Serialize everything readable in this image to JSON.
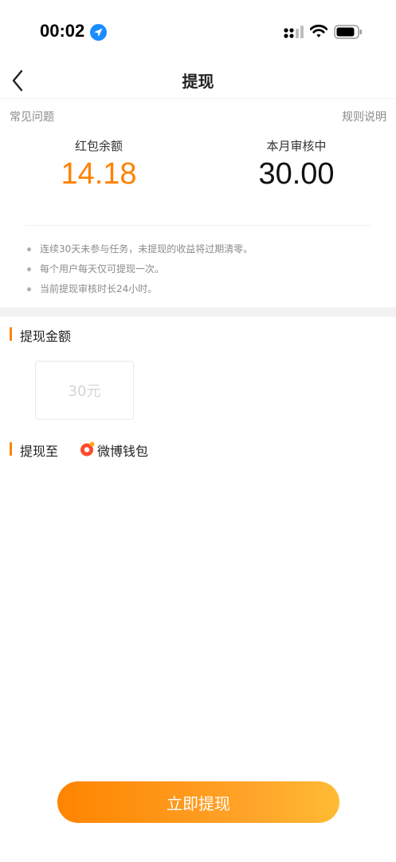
{
  "status_bar": {
    "time": "00:02"
  },
  "nav": {
    "title": "提现"
  },
  "links": {
    "faq": "常见问题",
    "rules": "规则说明"
  },
  "balances": {
    "red_packet_label": "红包余额",
    "red_packet_value": "14.18",
    "reviewing_label": "本月审核中",
    "reviewing_value": "30.00"
  },
  "notes": [
    "连续30天未参与任务，未提现的收益将过期清零。",
    "每个用户每天仅可提现一次。",
    "当前提现审核时长24小时。"
  ],
  "amount_section": {
    "title": "提现金额",
    "options": [
      "30元"
    ]
  },
  "destination_section": {
    "title": "提现至",
    "wallet_name": "微博钱包",
    "wallet_icon": "weibo-wallet-icon"
  },
  "action": {
    "withdraw_label": "立即提现"
  },
  "colors": {
    "accent": "#ff8200",
    "button_start": "#ff8400",
    "button_end": "#ffbb33"
  }
}
